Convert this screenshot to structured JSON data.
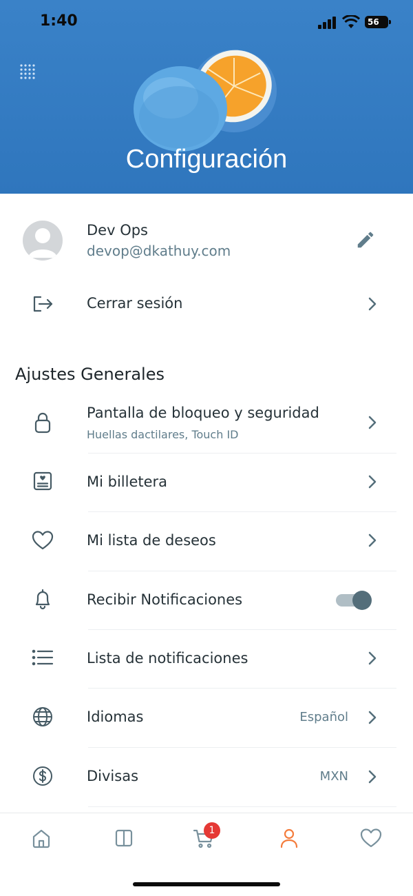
{
  "status_bar": {
    "time": "1:40",
    "battery": "56"
  },
  "header": {
    "title": "Configuración"
  },
  "profile": {
    "name": "Dev Ops",
    "email": "devop@dkathuy.com"
  },
  "logout": {
    "label": "Cerrar sesión"
  },
  "general": {
    "title": "Ajustes Generales",
    "lock": {
      "label": "Pantalla de bloqueo y seguridad",
      "sub": "Huellas dactilares, Touch ID"
    },
    "wallet": {
      "label": "Mi billetera"
    },
    "wishlist": {
      "label": "Mi lista de deseos"
    },
    "notifications": {
      "label": "Recibir Notificaciones",
      "enabled": true
    },
    "notif_list": {
      "label": "Lista de notificaciones"
    },
    "languages": {
      "label": "Idiomas",
      "value": "Español"
    },
    "currencies": {
      "label": "Divisas",
      "value": "MXN"
    }
  },
  "tab_bar": {
    "items": [
      "home-icon",
      "panels-icon",
      "cart-icon",
      "user-icon",
      "heart-icon"
    ],
    "cart_badge": "1",
    "active": "user-icon",
    "active_color": "#f47c3c"
  },
  "colors": {
    "header_bg": "#2f76bd",
    "text": "#263238",
    "muted": "#607d8b",
    "toggle_knob": "#546e7a"
  }
}
